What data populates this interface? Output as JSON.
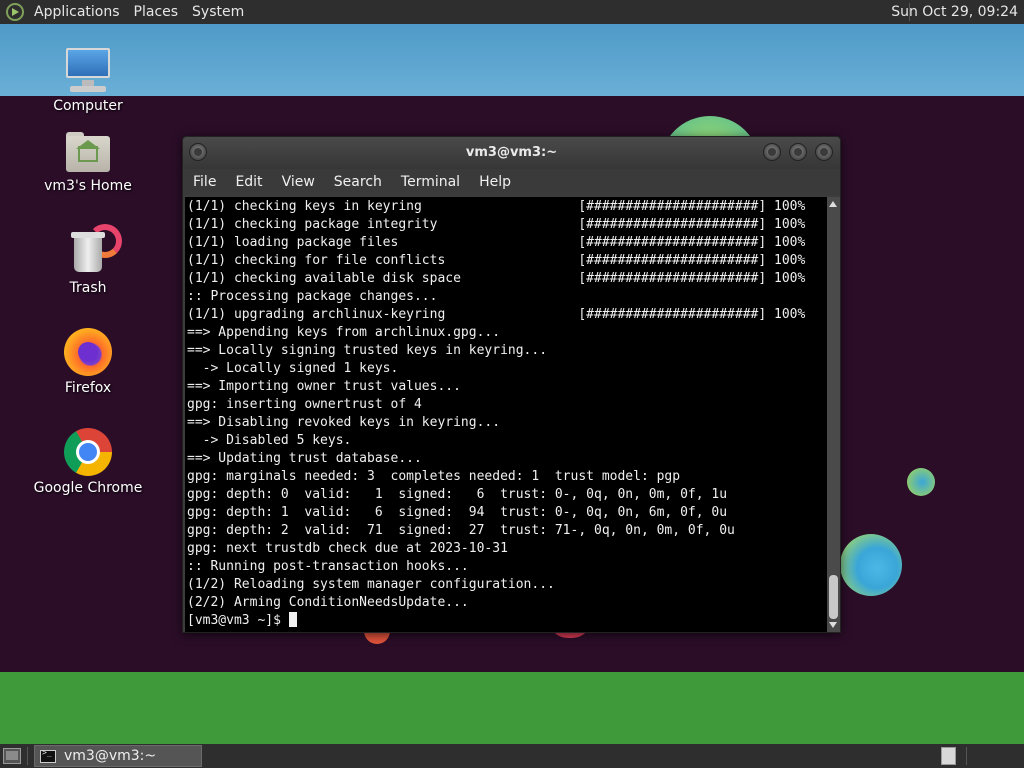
{
  "top_panel": {
    "menus": [
      "Applications",
      "Places",
      "System"
    ],
    "clock": "Sun Oct 29, 09:24"
  },
  "desktop": {
    "icons": [
      {
        "label": "Computer",
        "icon": "computer-icon"
      },
      {
        "label": "vm3's Home",
        "icon": "home-folder-icon"
      },
      {
        "label": "Trash",
        "icon": "trash-icon"
      },
      {
        "label": "Firefox",
        "icon": "firefox-icon"
      },
      {
        "label": "Google Chrome",
        "icon": "chrome-icon"
      }
    ]
  },
  "terminal": {
    "title": "vm3@vm3:~",
    "menu": [
      "File",
      "Edit",
      "View",
      "Search",
      "Terminal",
      "Help"
    ],
    "lines": [
      "(1/1) checking keys in keyring                    [######################] 100%",
      "(1/1) checking package integrity                  [######################] 100%",
      "(1/1) loading package files                       [######################] 100%",
      "(1/1) checking for file conflicts                 [######################] 100%",
      "(1/1) checking available disk space               [######################] 100%",
      ":: Processing package changes...",
      "(1/1) upgrading archlinux-keyring                 [######################] 100%",
      "==> Appending keys from archlinux.gpg...",
      "==> Locally signing trusted keys in keyring...",
      "  -> Locally signed 1 keys.",
      "==> Importing owner trust values...",
      "gpg: inserting ownertrust of 4",
      "==> Disabling revoked keys in keyring...",
      "  -> Disabled 5 keys.",
      "==> Updating trust database...",
      "gpg: marginals needed: 3  completes needed: 1  trust model: pgp",
      "gpg: depth: 0  valid:   1  signed:   6  trust: 0-, 0q, 0n, 0m, 0f, 1u",
      "gpg: depth: 1  valid:   6  signed:  94  trust: 0-, 0q, 0n, 6m, 0f, 0u",
      "gpg: depth: 2  valid:  71  signed:  27  trust: 71-, 0q, 0n, 0m, 0f, 0u",
      "gpg: next trustdb check due at 2023-10-31",
      ":: Running post-transaction hooks...",
      "(1/2) Reloading system manager configuration...",
      "(2/2) Arming ConditionNeedsUpdate..."
    ],
    "prompt": "[vm3@vm3 ~]$ "
  },
  "taskbar": {
    "task_label": "vm3@vm3:~"
  }
}
